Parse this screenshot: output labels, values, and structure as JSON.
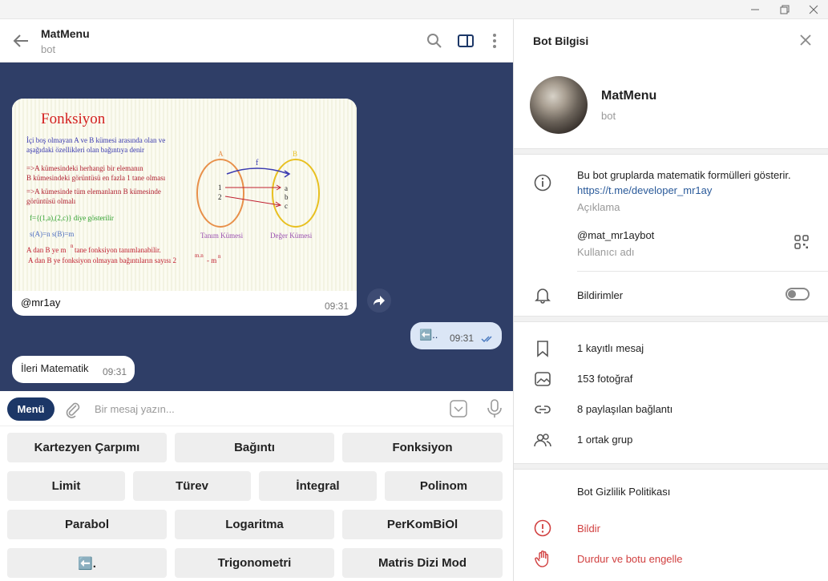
{
  "window": {
    "minimize_icon": "minimize-icon",
    "restore_icon": "restore-icon",
    "close_icon": "close-icon"
  },
  "chat": {
    "title": "MatMenu",
    "subtitle": "bot",
    "messages": {
      "photo": {
        "image_title": "Fonksiyon",
        "image_lines": [
          "İçi boş olmayan A ve B kümesi arasında olan ve",
          "aşağıdaki özellikleri olan bağıntıya denir",
          "=>A kümesindeki herhangi bir elemanın",
          "B kümesindeki görüntüsü en fazla 1 tane olması",
          "=>A kümesinde tüm elemanların B kümesinde",
          "görüntüsü olmalı",
          "f={(1,a),(2,c)} diye gösterilir",
          "s(A)=n    s(B)=m",
          "A dan B ye m",
          "n",
          " tane fonksiyon tanımlanabilir.",
          "A dan B ye fonksiyon olmayan bağıntıların sayısı  2",
          "m.n",
          " - m",
          "n"
        ],
        "diagram": {
          "set_a": "A",
          "set_b": "B",
          "func": "f",
          "a_items": [
            "1",
            "2"
          ],
          "b_items": [
            "a",
            "b",
            "c"
          ],
          "a_caption": "Tanım Kümesi",
          "b_caption": "Değer Kümesi"
        },
        "caption": "@mr1ay",
        "time": "09:31"
      },
      "outgoing": {
        "text": "⬅️..",
        "time": "09:31"
      },
      "incoming": {
        "text": "İleri Matematik",
        "time": "09:31"
      }
    }
  },
  "composer": {
    "menu_label": "Menü",
    "placeholder": "Bir mesaj yazın..."
  },
  "keyboard": {
    "row1": [
      "Kartezyen Çarpımı",
      "Bağıntı",
      "Fonksiyon"
    ],
    "row2": [
      "Limit",
      "Türev",
      "İntegral",
      "Polinom"
    ],
    "row3": [
      "Parabol",
      "Logaritma",
      "PerKomBiOl"
    ],
    "row4": [
      "⬅️.",
      "Trigonometri",
      "Matris Dizi Mod"
    ]
  },
  "info": {
    "title": "Bot Bilgisi",
    "name": "MatMenu",
    "type": "bot",
    "description": "Bu bot gruplarda matematik formülleri gösterir.",
    "description_link": "https://t.me/developer_mr1ay",
    "description_label": "Açıklama",
    "username": "@mat_mr1aybot",
    "username_label": "Kullanıcı adı",
    "notifications": "Bildirimler",
    "stats": [
      "1 kayıtlı mesaj",
      "153 fotoğraf",
      "8 paylaşılan bağlantı",
      "1 ortak grup"
    ],
    "privacy": "Bot Gizlilik Politikası",
    "report": "Bildir",
    "block": "Durdur ve botu engelle"
  },
  "colors": {
    "chat_bg": "#2f3e67",
    "menu_button": "#1c3767",
    "danger": "#d14040",
    "link": "#2a5a9a"
  }
}
